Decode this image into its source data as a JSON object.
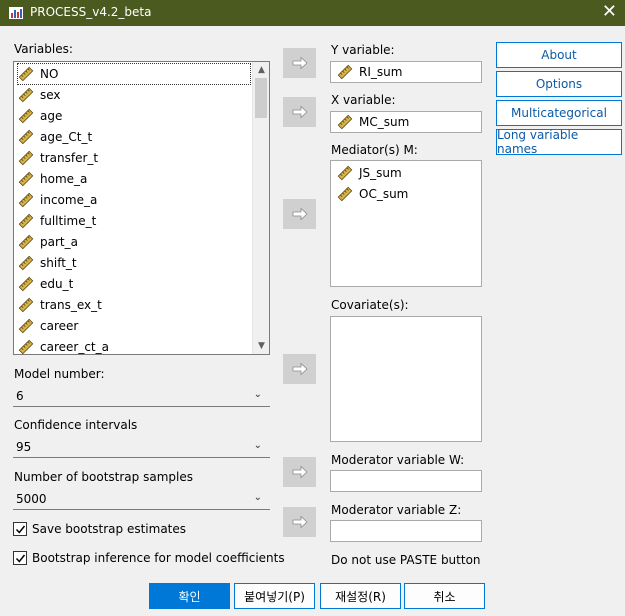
{
  "window": {
    "title": "PROCESS_v4.2_beta"
  },
  "variables": {
    "label": "Variables:",
    "items": [
      "NO",
      "sex",
      "age",
      "age_Ct_t",
      "transfer_t",
      "home_a",
      "income_a",
      "fulltime_t",
      "part_a",
      "shift_t",
      "edu_t",
      "trans_ex_t",
      "career",
      "career_ct_a"
    ]
  },
  "y_variable": {
    "label": "Y variable:",
    "value": "RI_sum"
  },
  "x_variable": {
    "label": "X variable:",
    "value": "MC_sum"
  },
  "mediators": {
    "label": "Mediator(s) M:",
    "items": [
      "JS_sum",
      "OC_sum"
    ]
  },
  "covariates": {
    "label": "Covariate(s):"
  },
  "moderator_w": {
    "label": "Moderator variable W:"
  },
  "moderator_z": {
    "label": "Moderator variable Z:"
  },
  "paste_note": "Do not use PASTE button",
  "side_buttons": {
    "about": "About",
    "options": "Options",
    "multicategorical": "Multicategorical",
    "long_names": "Long variable names"
  },
  "model": {
    "label": "Model number:",
    "value": "6"
  },
  "confidence": {
    "label": "Confidence intervals",
    "value": "95"
  },
  "bootstrap": {
    "label": "Number of bootstrap samples",
    "value": "5000"
  },
  "checkboxes": {
    "save_bootstrap": "Save bootstrap estimates",
    "bootstrap_inference": "Bootstrap inference for model coefficients"
  },
  "bottom_buttons": {
    "ok": "확인",
    "paste": "붙여넣기(P)",
    "reset": "재설정(R)",
    "cancel": "취소"
  },
  "colors": {
    "titlebar": "#4b5a1e",
    "accent": "#0078d7",
    "ruler": "#c8a23c"
  }
}
